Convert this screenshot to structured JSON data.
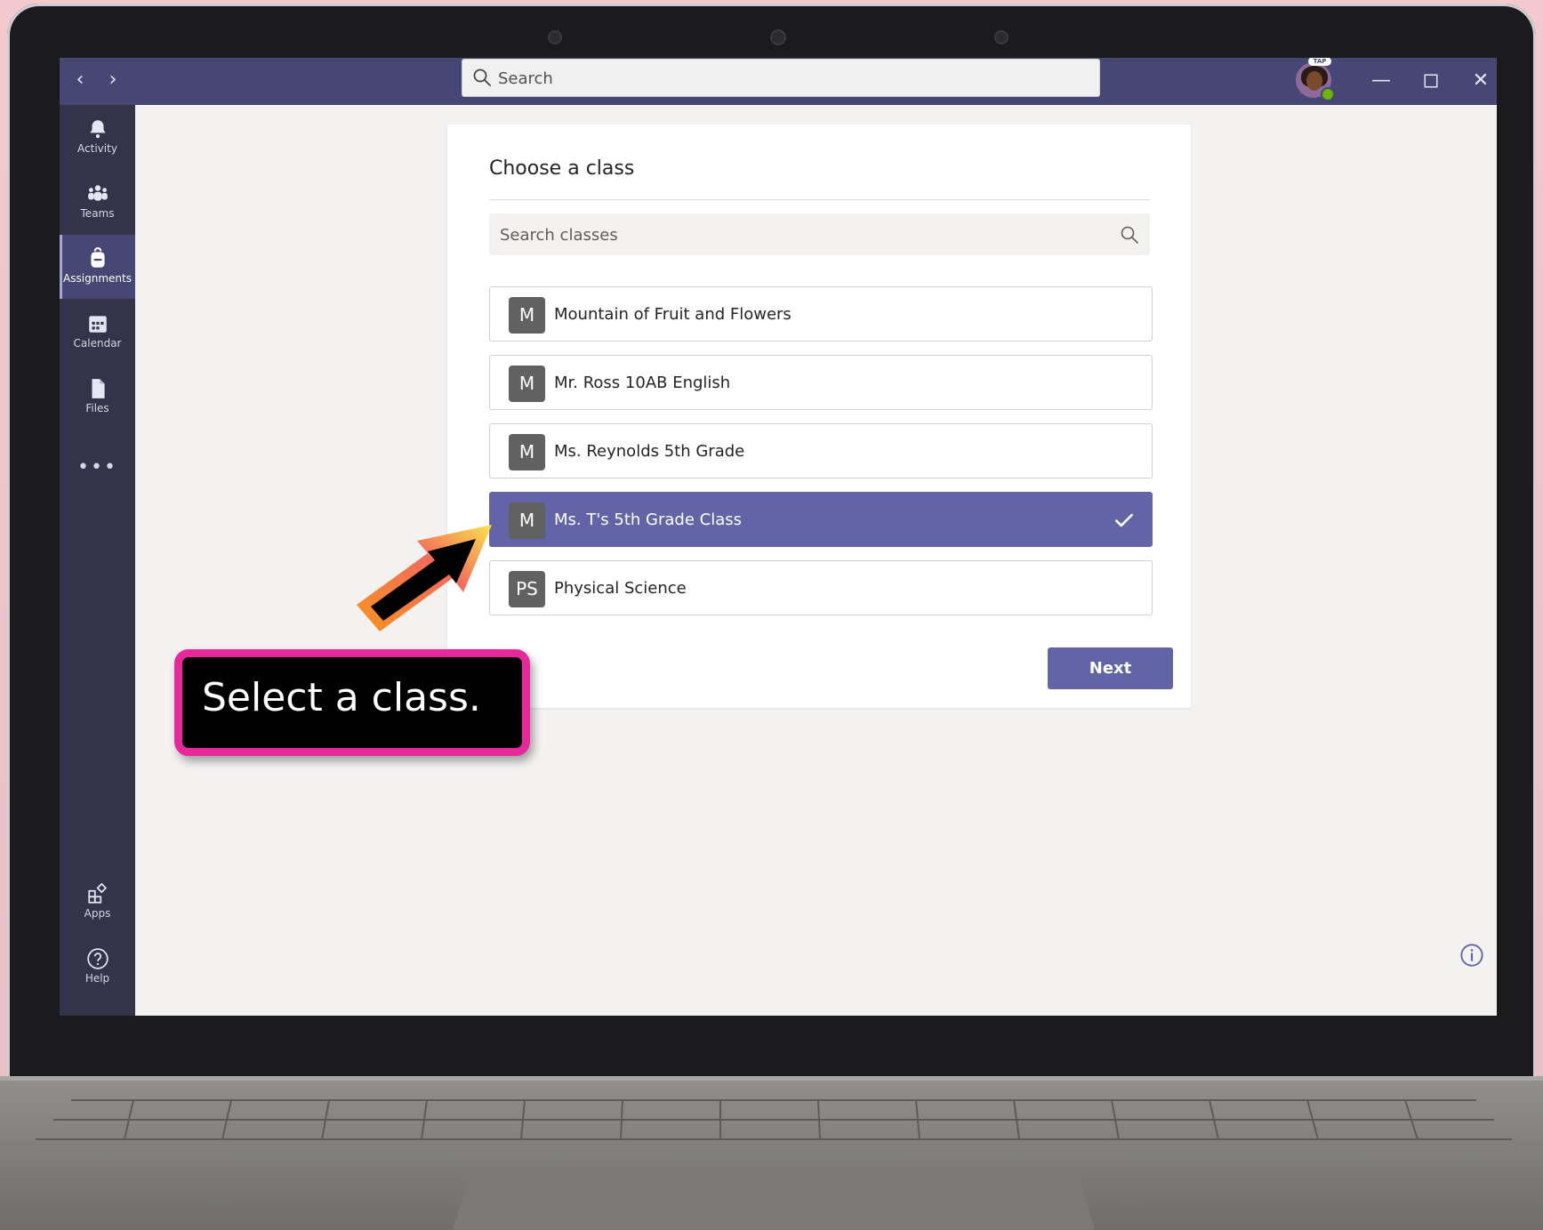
{
  "titlebar": {
    "search_placeholder": "Search",
    "avatar_tag": "TAP",
    "colors": {
      "bar": "#464775",
      "rail": "#33344a",
      "accent": "#6264a7"
    }
  },
  "rail": {
    "items": [
      {
        "label": "Activity",
        "icon": "bell-icon"
      },
      {
        "label": "Teams",
        "icon": "teams-icon"
      },
      {
        "label": "Assignments",
        "icon": "backpack-icon",
        "active": true
      },
      {
        "label": "Calendar",
        "icon": "calendar-icon"
      },
      {
        "label": "Files",
        "icon": "file-icon"
      },
      {
        "label": "Apps",
        "icon": "apps-icon"
      },
      {
        "label": "Help",
        "icon": "help-icon"
      }
    ],
    "more": "•••"
  },
  "card": {
    "title": "Choose a class",
    "search_placeholder": "Search classes",
    "classes": [
      {
        "badge": "M",
        "name": "Mountain of Fruit and Flowers",
        "selected": false
      },
      {
        "badge": "M",
        "name": "Mr. Ross 10AB English",
        "selected": false
      },
      {
        "badge": "M",
        "name": "Ms. Reynolds 5th Grade",
        "selected": false
      },
      {
        "badge": "M",
        "name": "Ms. T's 5th Grade Class",
        "selected": true
      },
      {
        "badge": "PS",
        "name": "Physical Science",
        "selected": false
      }
    ],
    "next_label": "Next"
  },
  "callout": {
    "text": "Select a class.",
    "border_color": "#e6289a"
  }
}
